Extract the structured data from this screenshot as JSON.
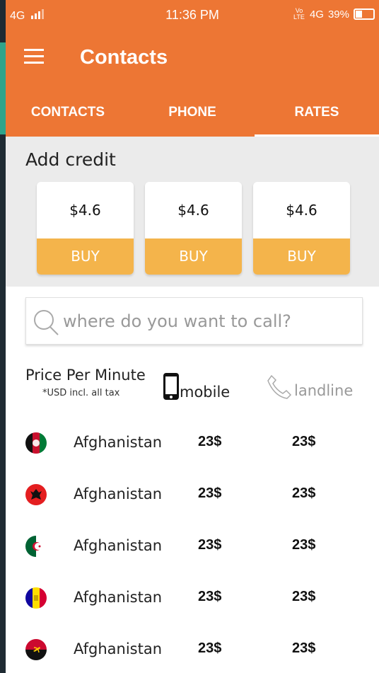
{
  "status": {
    "network_left": "4G",
    "time": "11:36 PM",
    "volte": "Vo LTE",
    "network_right": "4G",
    "battery": "39%"
  },
  "appbar": {
    "title": "Contacts"
  },
  "tabs": [
    {
      "label": "CONTACTS",
      "active": false
    },
    {
      "label": "PHONE",
      "active": false
    },
    {
      "label": "RATES",
      "active": true
    }
  ],
  "credit": {
    "title": "Add credit",
    "cards": [
      {
        "price": "$4.6",
        "button": "BUY"
      },
      {
        "price": "$4.6",
        "button": "BUY"
      },
      {
        "price": "$4.6",
        "button": "BUY"
      }
    ]
  },
  "search": {
    "value": "",
    "placeholder": "where do you want to call?"
  },
  "rates": {
    "title": "Price Per Minute",
    "subtitle": "*USD incl. all tax",
    "mobile_label": "mobile",
    "landline_label": "landline",
    "rows": [
      {
        "country": "Afghanistan",
        "mobile": "23$",
        "landline": "23$",
        "flag": "afghanistan-flag"
      },
      {
        "country": "Afghanistan",
        "mobile": "23$",
        "landline": "23$",
        "flag": "albania-flag"
      },
      {
        "country": "Afghanistan",
        "mobile": "23$",
        "landline": "23$",
        "flag": "algeria-flag"
      },
      {
        "country": "Afghanistan",
        "mobile": "23$",
        "landline": "23$",
        "flag": "andorra-flag"
      },
      {
        "country": "Afghanistan",
        "mobile": "23$",
        "landline": "23$",
        "flag": "angola-flag"
      }
    ]
  },
  "colors": {
    "primary": "#ed7634",
    "buy": "#f4b44b",
    "credit_bg": "#ebebeb"
  }
}
